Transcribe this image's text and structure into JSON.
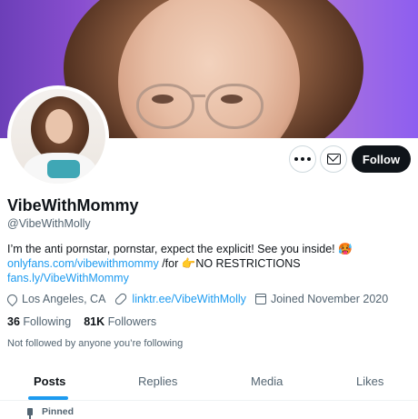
{
  "profile": {
    "display_name": "VibeWithMommy",
    "handle": "@VibeWithMolly",
    "bio_line1": "I’m the anti pornstar, pornstar, expect the explicit! See you inside! 🥵",
    "bio_link1": "onlyfans.com/vibewithmommy",
    "bio_for": " /for ",
    "bio_hand": "👉",
    "bio_restrictions": "NO RESTRICTIONS",
    "bio_link2": "fans.ly/VibeWithMommy",
    "location": "Los Angeles, CA",
    "website": "linktr.ee/VibeWithMolly",
    "joined": "Joined November 2020",
    "following_count": "36",
    "following_label": "Following",
    "followers_count": "81K",
    "followers_label": "Followers",
    "not_followed_text": "Not followed by anyone you’re following"
  },
  "actions": {
    "follow_label": "Follow",
    "more_icon": "more-icon",
    "message_icon": "envelope-icon"
  },
  "tabs": {
    "posts": "Posts",
    "replies": "Replies",
    "media": "Media",
    "likes": "Likes",
    "active": "Posts"
  },
  "pinned_label": "Pinned",
  "colors": {
    "accent": "#1d9bf0",
    "text": "#0f1419",
    "muted": "#536471",
    "follow_button": "#0f1419"
  }
}
